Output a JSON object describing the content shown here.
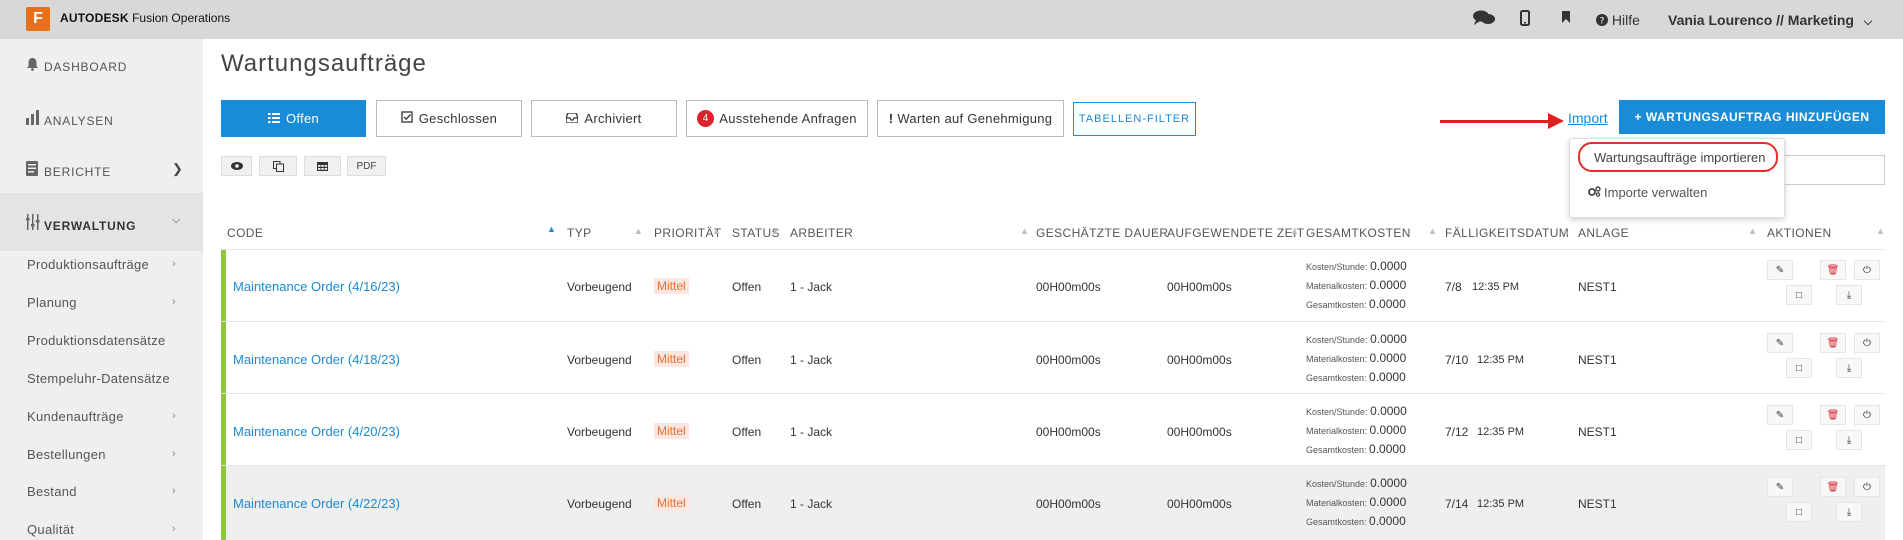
{
  "app": {
    "logo_letter": "F",
    "brand": "AUTODESK",
    "product": "Fusion Operations"
  },
  "topbar": {
    "help_label": "Hilfe",
    "user_label": "Vania Lourenco // Marketing"
  },
  "sidebar": {
    "main_items": [
      {
        "label": "DASHBOARD",
        "icon": "bell-icon"
      },
      {
        "label": "ANALYSEN",
        "icon": "bar-chart-icon"
      },
      {
        "label": "BERICHTE",
        "icon": "document-icon"
      },
      {
        "label": "VERWALTUNG",
        "icon": "sliders-icon"
      }
    ],
    "sub_items": [
      "Produktionsaufträge",
      "Planung",
      "Produktionsdatensätze",
      "Stempeluhr-Datensätze",
      "Kundenaufträge",
      "Bestellungen",
      "Bestand",
      "Qualität"
    ]
  },
  "page": {
    "title": "Wartungsaufträge"
  },
  "tabs": [
    {
      "label": "Offen",
      "icon": "list-icon"
    },
    {
      "label": "Geschlossen",
      "icon": "checkbox-icon"
    },
    {
      "label": "Archiviert",
      "icon": "archive-icon"
    },
    {
      "label": "Ausstehende Anfragen",
      "badge": "4"
    },
    {
      "label": "Warten auf Genehmigung",
      "icon": "exclamation-icon"
    },
    {
      "label": "TABELLEN-FILTER"
    }
  ],
  "view_buttons": {
    "pdf_label": "PDF"
  },
  "actions": {
    "import_label": "Import",
    "add_label": "+ WARTUNGSAUFTRAG HINZUFÜGEN"
  },
  "import_menu": {
    "item1": "Wartungsaufträge importieren",
    "item2": "Importe verwalten"
  },
  "table": {
    "headers": [
      "CODE",
      "TYP",
      "PRIORITÄT",
      "STATUS",
      "ARBEITER",
      "GESCHÄTZTE DAUER",
      "AUFGEWENDETE ZEIT",
      "GESAMTKOSTEN",
      "FÄLLIGKEITSDATUM",
      "ANLAGE",
      "AKTIONEN"
    ],
    "cost_labels": [
      "Kosten/Stunde:",
      "Materialkosten:",
      "Gesamtkosten:"
    ],
    "rows": [
      {
        "code": "Maintenance Order (4/16/23)",
        "type": "Vorbeugend",
        "priority": "Mittel",
        "status": "Offen",
        "worker": "1 - Jack",
        "est": "00H00m00s",
        "spent": "00H00m00s",
        "cost_hour": "0.0000",
        "cost_mat": "0.0000",
        "cost_total": "0.0000",
        "due_date": "7/8",
        "due_time": "12:35 PM",
        "asset": "NEST1"
      },
      {
        "code": "Maintenance Order (4/18/23)",
        "type": "Vorbeugend",
        "priority": "Mittel",
        "status": "Offen",
        "worker": "1 - Jack",
        "est": "00H00m00s",
        "spent": "00H00m00s",
        "cost_hour": "0.0000",
        "cost_mat": "0.0000",
        "cost_total": "0.0000",
        "due_date": "7/10",
        "due_time": "12:35 PM",
        "asset": "NEST1"
      },
      {
        "code": "Maintenance Order (4/20/23)",
        "type": "Vorbeugend",
        "priority": "Mittel",
        "status": "Offen",
        "worker": "1 - Jack",
        "est": "00H00m00s",
        "spent": "00H00m00s",
        "cost_hour": "0.0000",
        "cost_mat": "0.0000",
        "cost_total": "0.0000",
        "due_date": "7/12",
        "due_time": "12:35 PM",
        "asset": "NEST1"
      },
      {
        "code": "Maintenance Order (4/22/23)",
        "type": "Vorbeugend",
        "priority": "Mittel",
        "status": "Offen",
        "worker": "1 - Jack",
        "est": "00H00m00s",
        "spent": "00H00m00s",
        "cost_hour": "0.0000",
        "cost_mat": "0.0000",
        "cost_total": "0.0000",
        "due_date": "7/14",
        "due_time": "12:35 PM",
        "asset": "NEST1"
      }
    ]
  },
  "colors": {
    "accent": "#1a8bd6",
    "row_bar": "#8dc63f",
    "badge": "#d9232e",
    "priority": "#e8702a",
    "annotation": "#e02020"
  }
}
